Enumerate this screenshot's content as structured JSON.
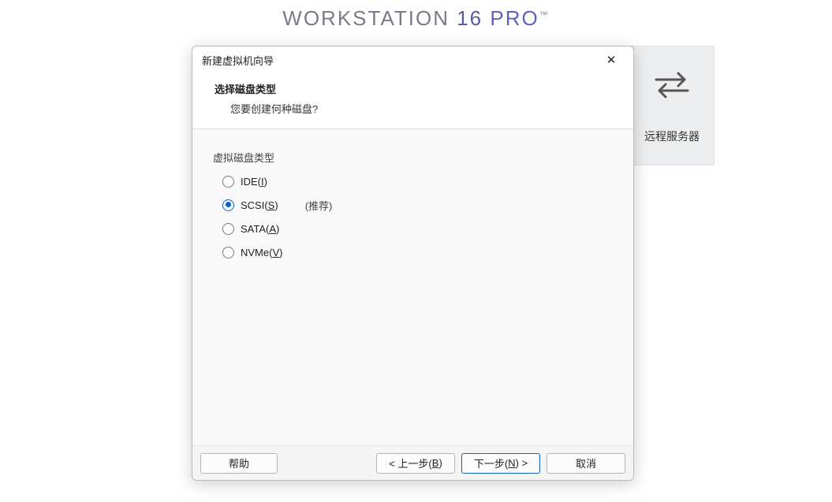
{
  "brand": {
    "word": "WORKSTATION",
    "version": "16",
    "edition": "PRO",
    "tm": "™"
  },
  "side_tile": {
    "label": "远程服务器"
  },
  "dialog": {
    "title": "新建虚拟机向导",
    "close_glyph": "✕",
    "header_title": "选择磁盘类型",
    "header_subtitle": "您要创建何种磁盘?",
    "group_label": "虚拟磁盘类型",
    "options": {
      "ide": {
        "pre": "IDE(",
        "key": "I",
        "post": ")",
        "hint": "",
        "selected": false
      },
      "scsi": {
        "pre": "SCSI(",
        "key": "S",
        "post": ")",
        "hint": "(推荐)",
        "selected": true
      },
      "sata": {
        "pre": "SATA(",
        "key": "A",
        "post": ")",
        "hint": "",
        "selected": false
      },
      "nvme": {
        "pre": "NVMe(",
        "key": "V",
        "post": ")",
        "hint": "",
        "selected": false
      }
    },
    "buttons": {
      "help": {
        "label": "帮助"
      },
      "back": {
        "pre": "< 上一步(",
        "key": "B",
        "post": ")"
      },
      "next": {
        "pre": "下一步(",
        "key": "N",
        "post": ") >"
      },
      "cancel": {
        "label": "取消"
      }
    }
  }
}
